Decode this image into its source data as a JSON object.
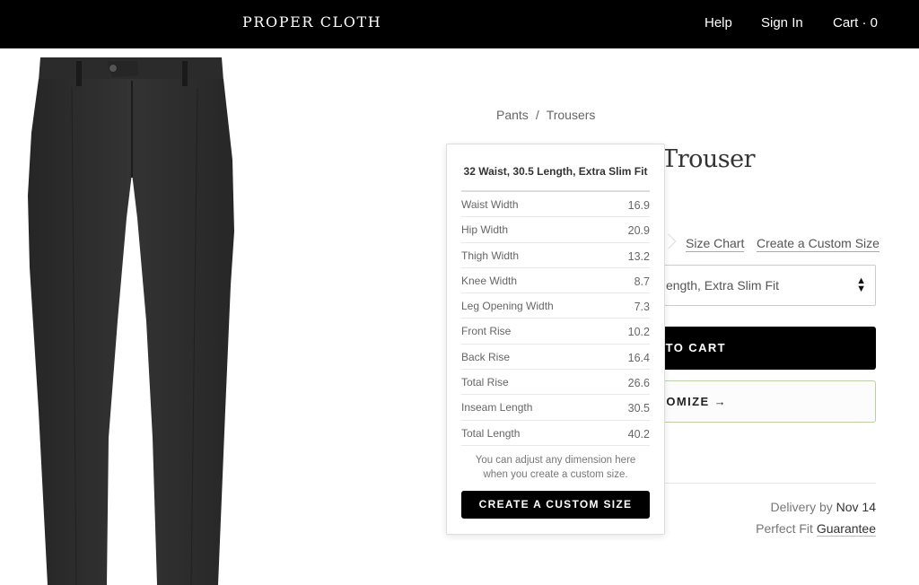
{
  "header": {
    "brand": "PROPER CLOTH",
    "nav": {
      "help": "Help",
      "sign_in": "Sign In",
      "cart": "Cart · 0"
    }
  },
  "product": {
    "image_alt": "charcoal-trousers",
    "breadcrumb": [
      "Pants",
      "Trousers"
    ],
    "breadcrumb_sep": "/",
    "title_visible": "l Trouser",
    "links": {
      "size_chart": "Size Chart",
      "create_custom": "Create a Custom Size"
    },
    "size_select": {
      "value": "32 Waist, 30.5 Length, Extra Slim Fit",
      "visible_value": "ength, Extra Slim Fit",
      "arrows_icon": "updown-caret-icon"
    },
    "add_to_cart_visible": "D TO CART",
    "customize_visible": "STOMIZE →",
    "delivery": {
      "label": "Delivery by",
      "date": "Nov 14"
    },
    "guarantee": {
      "label": "Perfect Fit",
      "link": "Guarantee"
    }
  },
  "popover": {
    "title": "32 Waist, 30.5 Length, Extra Slim Fit",
    "rows": [
      {
        "label": "Waist Width",
        "value": "16.9"
      },
      {
        "label": "Hip Width",
        "value": "20.9"
      },
      {
        "label": "Thigh Width",
        "value": "13.2"
      },
      {
        "label": "Knee Width",
        "value": "8.7"
      },
      {
        "label": "Leg Opening Width",
        "value": "7.3"
      },
      {
        "label": "Front Rise",
        "value": "10.2"
      },
      {
        "label": "Back Rise",
        "value": "16.4"
      },
      {
        "label": "Total Rise",
        "value": "26.6"
      },
      {
        "label": "Inseam Length",
        "value": "30.5"
      },
      {
        "label": "Total Length",
        "value": "40.2"
      }
    ],
    "note_line1": "You can adjust any dimension here",
    "note_line2": "when you create a custom size.",
    "button": "CREATE A CUSTOM SIZE"
  },
  "colors": {
    "header_bg": "#000000",
    "primary_button": "#000000",
    "customize_border": "#b9d29f",
    "fabric": "#2e2e2e"
  }
}
